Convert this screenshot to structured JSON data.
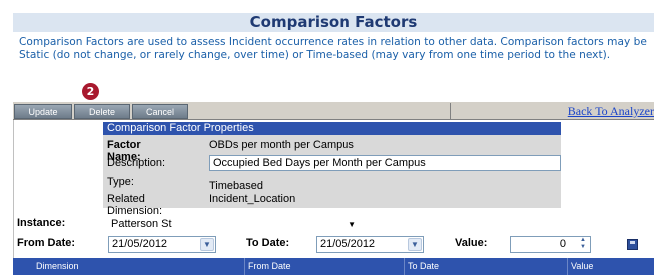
{
  "header": {
    "title": "Comparison Factors",
    "description": "Comparison Factors are used to assess Incident occurrence rates in relation to other data. Comparison factors may be Static (do not change, or rarely change, over time) or Time-based (may vary from one time period to the next)."
  },
  "annotation": {
    "badge": "2"
  },
  "toolbar": {
    "update_label": "Update",
    "delete_label": "Delete",
    "cancel_label": "Cancel",
    "back_link": "Back To Analyzer"
  },
  "properties": {
    "header": "Comparison Factor Properties",
    "factor_name_label": "Factor Name:",
    "factor_name_value": "OBDs per month per Campus",
    "description_label": "Description:",
    "description_value": "Occupied Bed Days per Month per Campus",
    "type_label": "Type:",
    "type_value": "Timebased",
    "related_dimension_label": "Related Dimension:",
    "related_dimension_value": "Incident_Location"
  },
  "filters": {
    "instance_label": "Instance:",
    "instance_value": "Patterson St",
    "from_date_label": "From Date:",
    "from_date_value": "21/05/2012",
    "to_date_label": "To Date:",
    "to_date_value": "21/05/2012",
    "value_label": "Value:",
    "value_value": "0"
  },
  "grid": {
    "columns": [
      "Dimension",
      "From Date",
      "To Date",
      "Value"
    ]
  },
  "icons": {
    "dropdown": "chevron-down-icon",
    "spinner": "spinner-icon",
    "save": "save-icon"
  },
  "colors": {
    "title_bg": "#dbe5f1",
    "accent_blue": "#2e53ad",
    "badge_red": "#a8192e",
    "description_text": "#1a5fa8"
  }
}
